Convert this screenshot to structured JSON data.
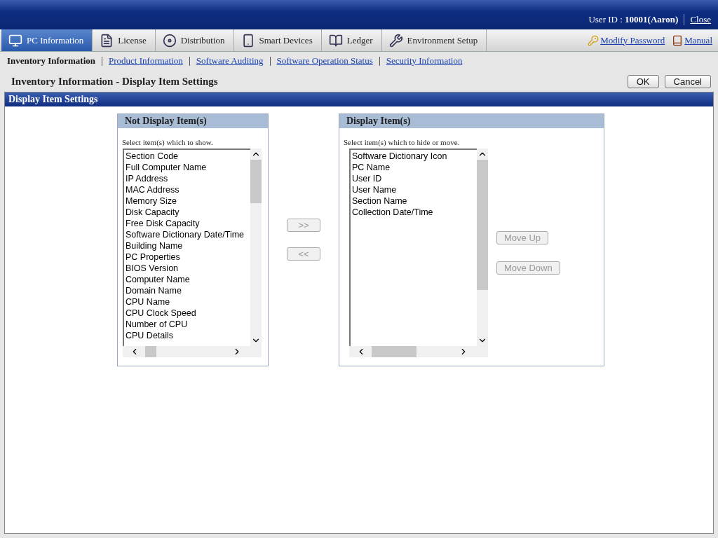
{
  "header": {
    "user_label": "User ID : ",
    "user_value": "10001(Aaron)",
    "close": "Close"
  },
  "tabs": [
    {
      "label": "PC Information",
      "selected": true
    },
    {
      "label": "License",
      "selected": false
    },
    {
      "label": "Distribution",
      "selected": false
    },
    {
      "label": "Smart Devices",
      "selected": false
    },
    {
      "label": "Ledger",
      "selected": false
    },
    {
      "label": "Environment Setup",
      "selected": false
    }
  ],
  "top_links": [
    "Modify Password",
    "Manual"
  ],
  "subnav": [
    {
      "label": "Inventory Information",
      "selected": true
    },
    {
      "label": "Product Information",
      "selected": false
    },
    {
      "label": "Software Auditing",
      "selected": false
    },
    {
      "label": "Software Operation Status",
      "selected": false
    },
    {
      "label": "Security Information",
      "selected": false
    }
  ],
  "page_title": "Inventory Information - Display Item Settings",
  "actions": [
    "OK",
    "Cancel"
  ],
  "section_title": "Display Item Settings",
  "not_display": {
    "title": "Not Display Item(s)",
    "hint": "Select item(s) which to show.",
    "items": [
      "Section Code",
      "Full Computer Name",
      "IP Address",
      "MAC Address",
      "Memory Size",
      "Disk Capacity",
      "Free Disk Capacity",
      "Software Dictionary Date/Time",
      "Building Name",
      "PC Properties",
      "BIOS Version",
      "Computer Name",
      "Domain Name",
      "CPU Name",
      "CPU Clock Speed",
      "Number of CPU",
      "CPU Details"
    ]
  },
  "transfer_buttons": [
    {
      "label": ">>",
      "disabled": true
    },
    {
      "label": "<<",
      "disabled": true
    }
  ],
  "display": {
    "title": "Display Item(s)",
    "hint": "Select item(s) which to hide or move.",
    "items": [
      "Software Dictionary Icon",
      "PC Name",
      "User ID",
      "User Name",
      "Section Name",
      "Collection Date/Time"
    ]
  },
  "move_buttons": [
    {
      "label": "Move Up",
      "disabled": true
    },
    {
      "label": "Move Down",
      "disabled": true
    }
  ]
}
